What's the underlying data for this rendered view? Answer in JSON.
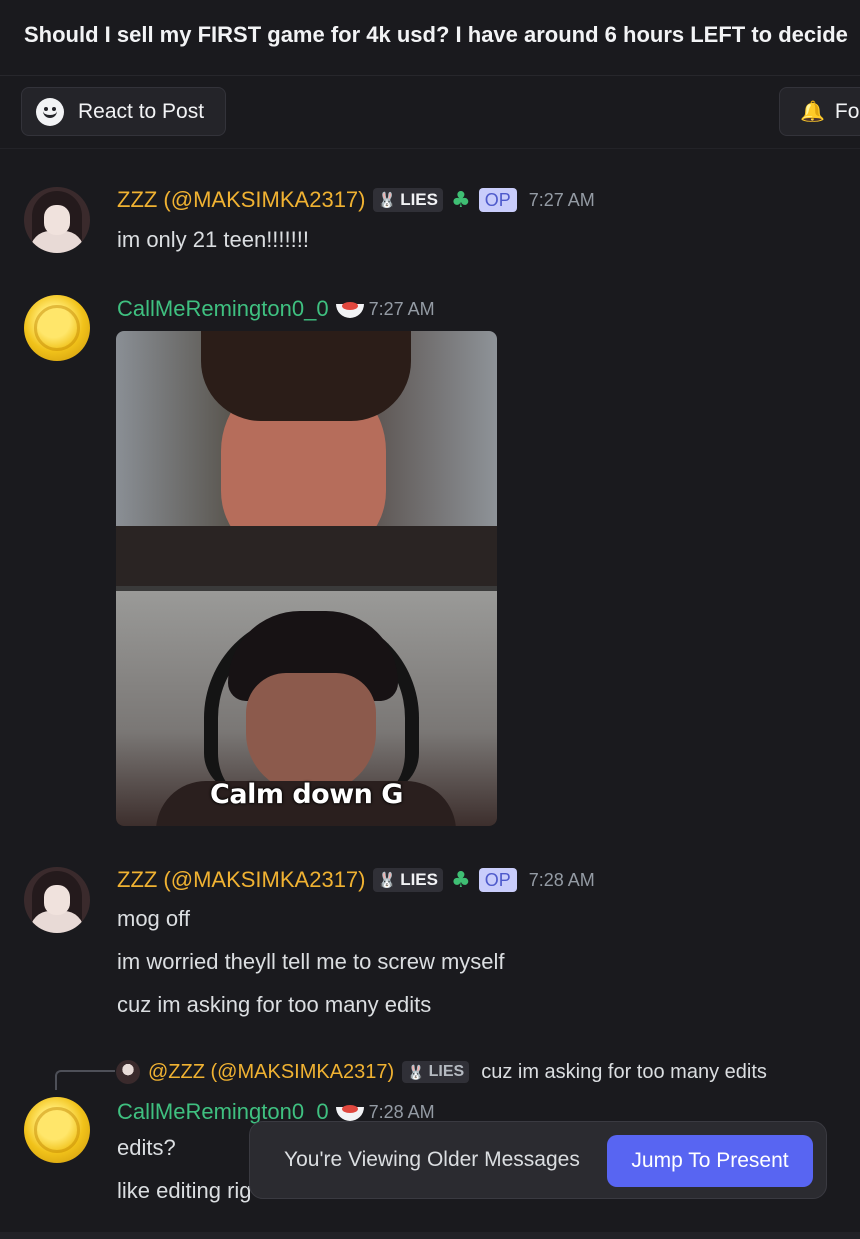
{
  "thread": {
    "title": "Should I sell my FIRST game for 4k usd? I have around 6 hours LEFT to decide"
  },
  "actions": {
    "react_label": "React to Post",
    "follow_label": "Follow"
  },
  "users": {
    "zzz": {
      "name": "ZZZ (@MAKSIMKA2317)",
      "tag": "LIES",
      "op_badge": "OP",
      "color": "#f0b232"
    },
    "call": {
      "name": "CallMeRemington0_0",
      "color": "#3fc080"
    }
  },
  "messages": [
    {
      "author": "ZZZ (@MAKSIMKA2317)",
      "time": "7:27 AM",
      "lines": [
        "im only 21 teen!!!!!!!"
      ]
    },
    {
      "author": "CallMeRemington0_0",
      "time": "7:27 AM",
      "image_caption": "Calm down G"
    },
    {
      "author": "ZZZ (@MAKSIMKA2317)",
      "time": "7:28 AM",
      "lines": [
        "mog off",
        "im worried theyll tell me to screw myself",
        "cuz im asking for too many edits"
      ]
    },
    {
      "reply_to": {
        "name": "@ZZZ (@MAKSIMKA2317)",
        "tag": "LIES",
        "text": "cuz im asking for too many edits"
      },
      "author": "CallMeRemington0_0",
      "time": "7:28 AM",
      "lines": [
        "edits?",
        "like editing rig"
      ]
    }
  ],
  "older_banner": {
    "text": "You're Viewing Older Messages",
    "jump_label": "Jump To Present"
  }
}
